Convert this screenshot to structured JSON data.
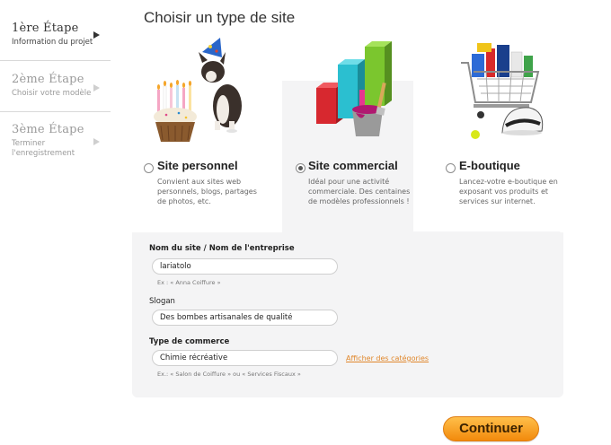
{
  "steps": [
    {
      "title": "1ère Étape",
      "subtitle": "Information du projet",
      "active": true
    },
    {
      "title": "2ème Étape",
      "subtitle": "Choisir votre modèle",
      "active": false
    },
    {
      "title": "3ème Étape",
      "subtitle": "Terminer l'enregistrement",
      "active": false
    }
  ],
  "page_title": "Choisir un type de site",
  "site_types": [
    {
      "label": "Site personnel",
      "description": "Convient aux sites web personnels, blogs, partages de photos, etc.",
      "selected": false,
      "image_icon": "birthday-cupcake-dog-icon"
    },
    {
      "label": "Site commercial",
      "description": "Idéal pour une activité commerciale. Des centaines de modèles professionnels !",
      "selected": true,
      "image_icon": "bar-chart-paint-bucket-icon"
    },
    {
      "label": "E-boutique",
      "description": "Lancez-votre e-boutique en exposant vos produits et services sur internet.",
      "selected": false,
      "image_icon": "shopping-cart-icon"
    }
  ],
  "form": {
    "name_label": "Nom du site / Nom de l'entreprise",
    "name_value": "lariatolo",
    "name_hint": "Ex : « Anna Coiffure »",
    "slogan_label": "Slogan",
    "slogan_value": "Des bombes artisanales de qualité",
    "business_label": "Type de commerce",
    "business_value": "Chimie récréative",
    "business_hint": "Ex.: « Salon de Coiffure » ou « Services Fiscaux »",
    "categories_link": "Afficher des catégories"
  },
  "continue_label": "Continuer",
  "colors": {
    "accent_orange": "#f28a0c",
    "link_orange": "#e0872b",
    "panel_bg": "#f4f4f5"
  }
}
